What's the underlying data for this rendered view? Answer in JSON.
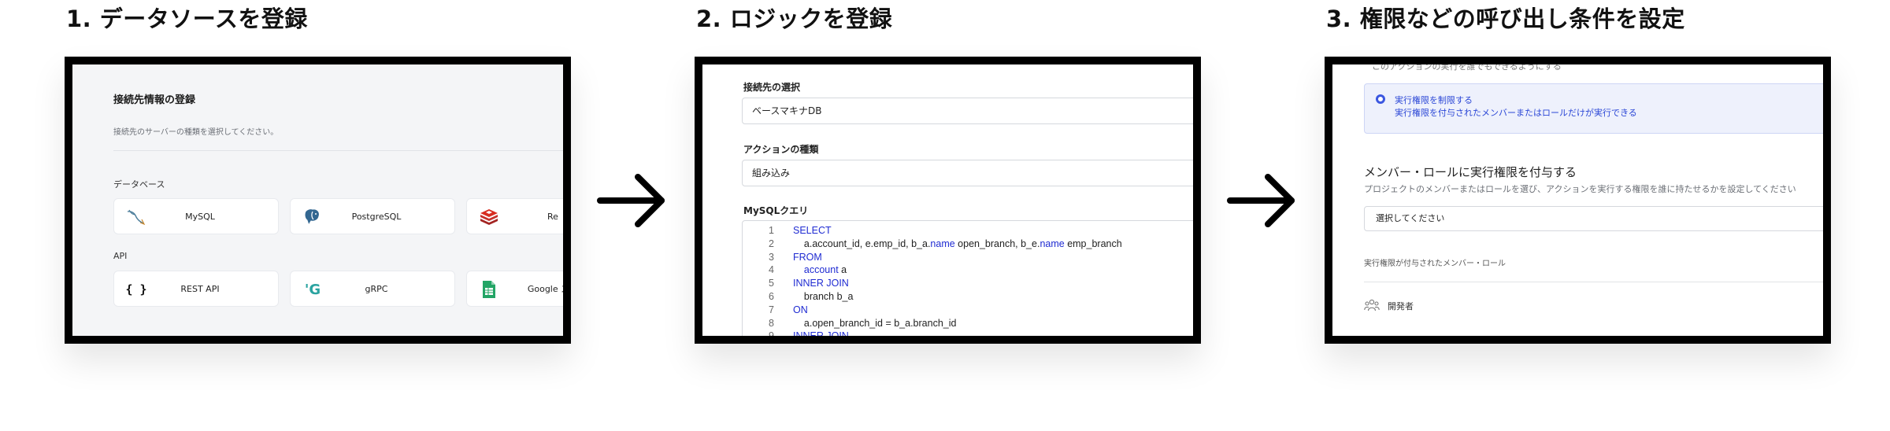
{
  "steps": [
    {
      "title": "1. データソースを登録"
    },
    {
      "title": "2. ロジックを登録"
    },
    {
      "title": "3. 権限などの呼び出し条件を設定"
    }
  ],
  "panel1": {
    "heading": "接続先情報の登録",
    "subtext": "接続先のサーバーの種類を選択してください。",
    "categories": [
      "データベース",
      "API"
    ],
    "database_cards": [
      {
        "label": "MySQL",
        "icon": "mysql-dolphin-icon"
      },
      {
        "label": "PostgreSQL",
        "icon": "postgresql-elephant-icon"
      },
      {
        "label": "Re",
        "icon": "redis-icon"
      }
    ],
    "api_cards": [
      {
        "label": "REST API",
        "icon": "braces-icon",
        "glyph": "{ }"
      },
      {
        "label": "gRPC",
        "icon": "grpc-icon",
        "glyph": "'G"
      },
      {
        "label": "Google スプ",
        "icon": "google-sheets-icon"
      }
    ]
  },
  "panel2": {
    "connection_label": "接続先の選択",
    "connection_value": "ベースマキナDB",
    "action_type_label": "アクションの種類",
    "action_type_value": "組み込み",
    "query_label": "MySQLクエリ",
    "code": [
      {
        "n": "1",
        "parts": [
          {
            "t": "SELECT",
            "kw": true
          }
        ]
      },
      {
        "n": "2",
        "parts": [
          {
            "t": "    a.account_id, e.emp_id, b_a.",
            "kw": false
          },
          {
            "t": "name",
            "kw": true
          },
          {
            "t": " open_branch, b_e.",
            "kw": false
          },
          {
            "t": "name",
            "kw": true
          },
          {
            "t": " emp_branch",
            "kw": false
          }
        ]
      },
      {
        "n": "3",
        "parts": [
          {
            "t": "FROM",
            "kw": true
          }
        ]
      },
      {
        "n": "4",
        "parts": [
          {
            "t": "    account",
            "kw": true
          },
          {
            "t": " a",
            "kw": false
          }
        ]
      },
      {
        "n": "5",
        "parts": [
          {
            "t": "INNER JOIN",
            "kw": true
          }
        ]
      },
      {
        "n": "6",
        "parts": [
          {
            "t": "    branch b_a",
            "kw": false
          }
        ]
      },
      {
        "n": "7",
        "parts": [
          {
            "t": "ON",
            "kw": true
          }
        ]
      },
      {
        "n": "8",
        "parts": [
          {
            "t": "    a.open_branch_id = b_a.branch_id",
            "kw": false
          }
        ]
      },
      {
        "n": "9",
        "parts": [
          {
            "t": "INNER JOIN",
            "kw": true
          }
        ]
      }
    ]
  },
  "panel3": {
    "cut_text": "このアクションの実行を誰でもできるようにする",
    "radio_title": "実行権限を制限する",
    "radio_desc": "実行権限を付与されたメンバーまたはロールだけが実行できる",
    "section_title": "メンバー・ロールに実行権限を付与する",
    "section_desc": "プロジェクトのメンバーまたはロールを選び、アクションを実行する権限を誰に持たせるかを設定してください",
    "select_placeholder": "選択してください",
    "list_heading": "実行権限が付与されたメンバー・ロール",
    "members": [
      {
        "name": "開発者",
        "icon": "group-icon"
      }
    ]
  },
  "colors": {
    "frame_border": "#000000",
    "keyword": "#1f2bd2",
    "radio_accent": "#3b57e0",
    "radio_bg": "#eef1fc"
  }
}
